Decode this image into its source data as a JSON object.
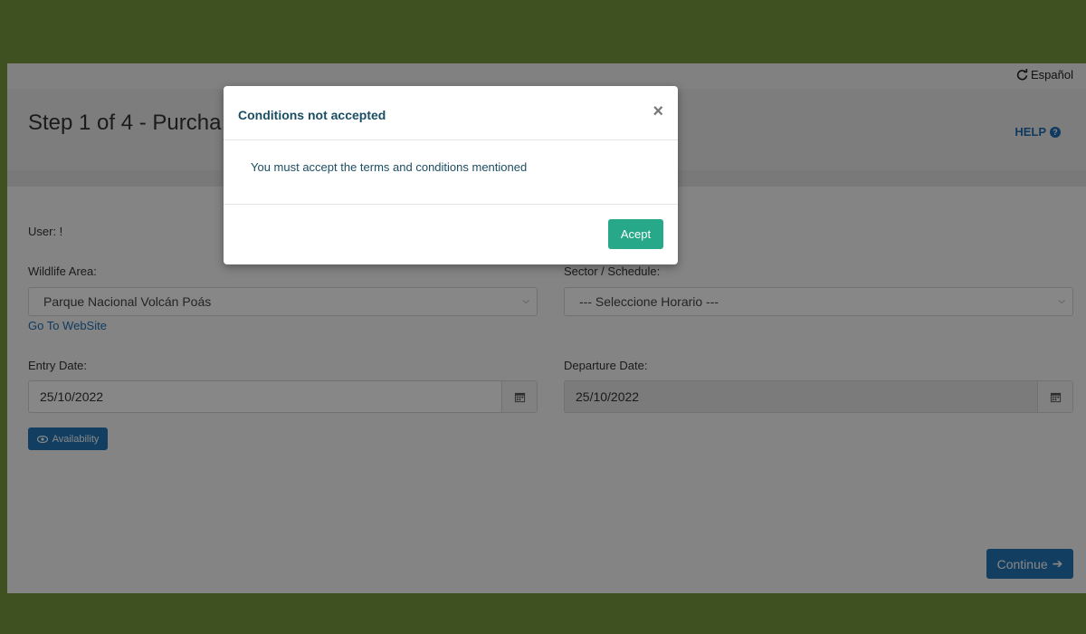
{
  "topbar": {
    "language_label": "Español"
  },
  "header": {
    "title": "Step 1 of 4 - Purcha",
    "help_label": "HELP"
  },
  "form": {
    "user_label": "User: !",
    "wildlife_label": "Wildlife Area:",
    "wildlife_value": "Parque Nacional Volcán Poás",
    "website_link": "Go To WebSite",
    "sector_label": "Sector / Schedule:",
    "sector_value": "--- Seleccione Horario ---",
    "entry_label": "Entry Date:",
    "entry_value": "25/10/2022",
    "departure_label": "Departure Date:",
    "departure_value": "25/10/2022",
    "availability_button": "Availability",
    "continue_button": "Continue"
  },
  "modal": {
    "title": "Conditions not accepted",
    "close_symbol": "×",
    "message": "You must accept the terms and conditions mentioned",
    "accept_button": "Acept"
  },
  "colors": {
    "page_background": "#3f5121",
    "primary_button": "#2377b8",
    "accept_button": "#26a889",
    "modal_text": "#1b4e63"
  }
}
